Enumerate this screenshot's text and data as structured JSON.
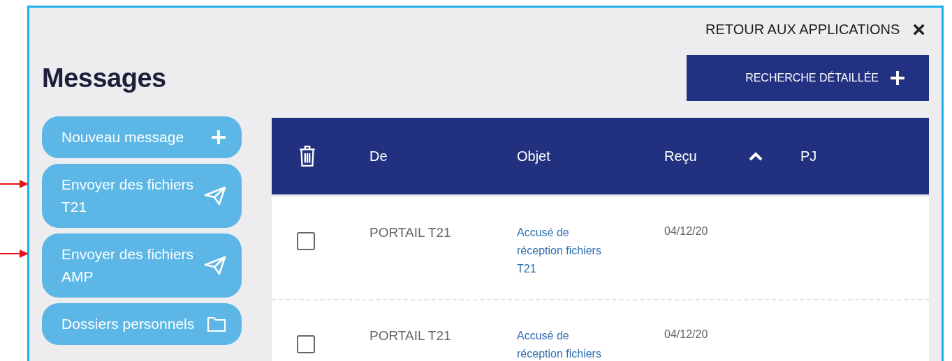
{
  "header": {
    "back_link": "RETOUR AUX APPLICATIONS",
    "close": "×"
  },
  "title": "Messages",
  "search_button": {
    "label": "RECHERCHE DÉTAILLÉE"
  },
  "sidebar": {
    "buttons": [
      {
        "label": "Nouveau message",
        "kind": "plus",
        "highlighted": false
      },
      {
        "label": "Envoyer des fichiers T21",
        "kind": "send",
        "highlighted": true
      },
      {
        "label": "Envoyer des fichiers AMP",
        "kind": "send",
        "highlighted": true
      },
      {
        "label": "Dossiers personnels",
        "kind": "folder",
        "highlighted": false
      }
    ]
  },
  "table": {
    "columns": [
      {
        "label": "De",
        "sorted": false
      },
      {
        "label": "Objet",
        "sorted": false
      },
      {
        "label": "Reçu",
        "sorted": true
      },
      {
        "label": "PJ",
        "sorted": false
      }
    ],
    "rows": [
      {
        "checked": false,
        "from": "PORTAIL T21",
        "subject": "Accusé de réception fichiers T21",
        "received": "04/12/20"
      },
      {
        "checked": false,
        "from": "PORTAIL T21",
        "subject": "Accusé de réception fichiers",
        "received": "04/12/20"
      }
    ]
  }
}
